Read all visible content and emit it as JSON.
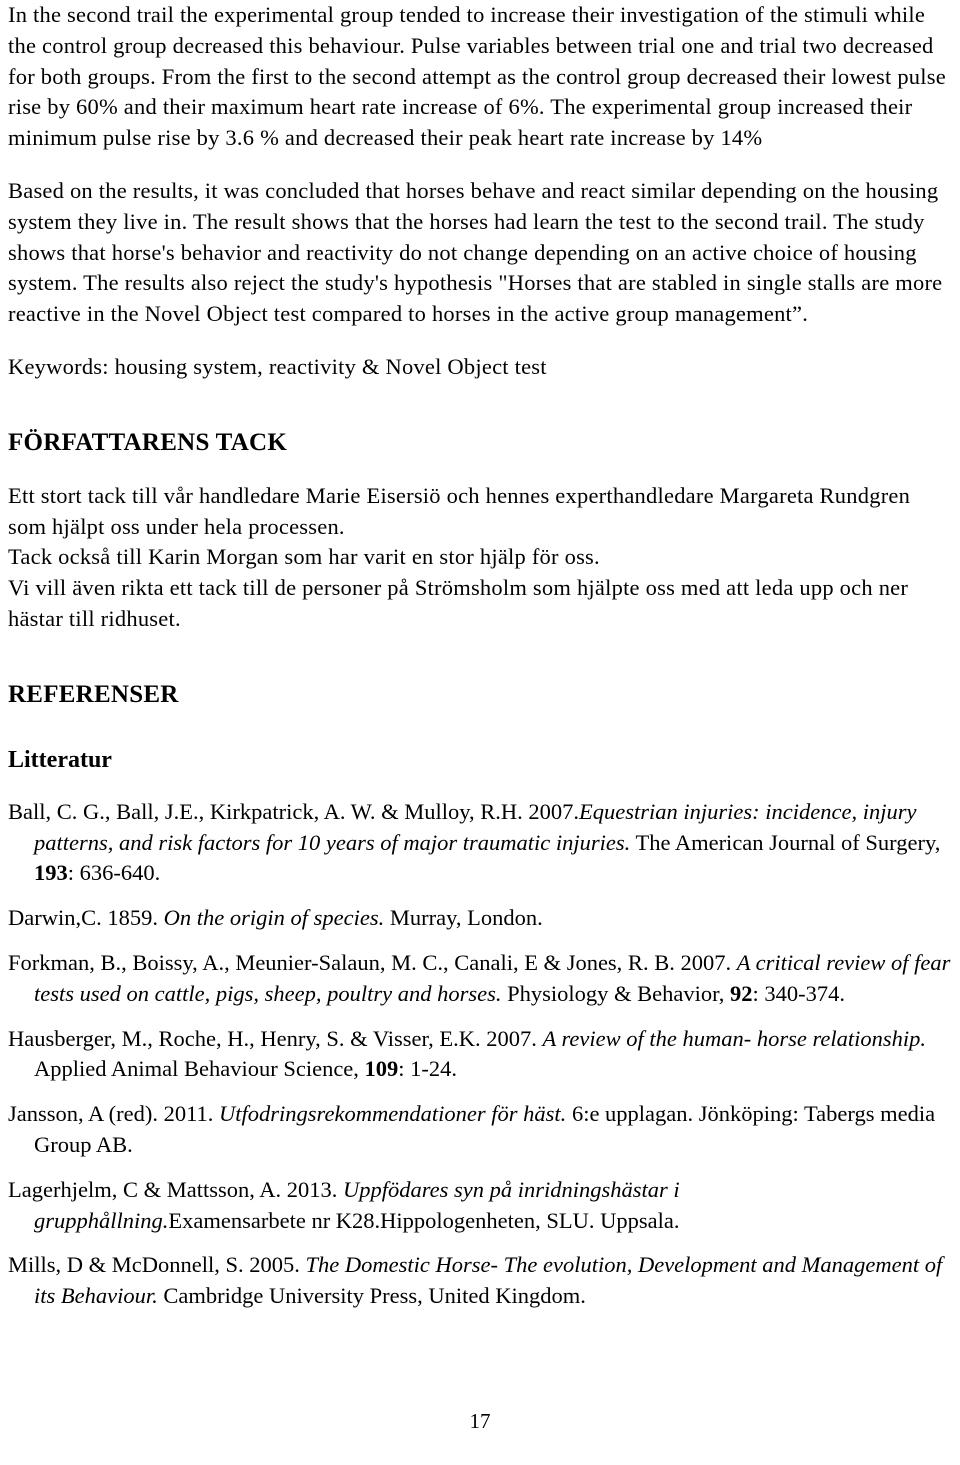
{
  "document": {
    "page_number": "17",
    "paragraphs": {
      "results_summary": "In the second trail the experimental group tended to increase their investigation of the stimuli while the control group decreased this behaviour. Pulse variables between trial one and trial two decreased for both groups. From the first to the second attempt as the control group decreased their lowest pulse rise by 60% and their maximum heart rate increase of 6%. The experimental group increased their minimum pulse rise by 3.6 % and decreased their peak heart rate increase by 14%",
      "conclusion": "Based on the results, it was concluded that horses behave and react similar depending on the housing system they live in. The result shows that the horses had learn the test to the second trail. The study shows that horse's behavior and reactivity do not change depending on an active choice of housing system. The results also reject the study's hypothesis \"Horses that are stabled in single stalls are more reactive in the Novel Object test compared to horses in the active group management”.",
      "keywords": "Keywords: housing system, reactivity & Novel Object test"
    },
    "acknowledgements": {
      "heading": "FÖRFATTARENS TACK",
      "line1": "Ett stort tack till vår handledare Marie Eisersiö och hennes experthandledare Margareta Rundgren som hjälpt oss under hela processen.",
      "line2": "Tack också till Karin Morgan som har varit en stor hjälp för oss.",
      "line3": "Vi vill även rikta ett tack till de personer på Strömsholm som hjälpte oss med att leda upp och ner hästar till ridhuset."
    },
    "references": {
      "heading": "REFERENSER",
      "subheading": "Litteratur",
      "items": [
        {
          "pre": "Ball, C. G., Ball, J.E., Kirkpatrick, A. W. & Mulloy, R.H. 2007.",
          "title": "Equestrian injuries: incidence, injury patterns, and risk factors for 10 years of major traumatic injuries.",
          "mid": " The American Journal of Surgery, ",
          "volume": "193",
          "post": ": 636-640."
        },
        {
          "pre": "Darwin,C. 1859. ",
          "title": "On the origin of species.",
          "mid": " Murray, London.",
          "volume": "",
          "post": ""
        },
        {
          "pre": "Forkman, B., Boissy, A., Meunier-Salaun, M. C., Canali, E & Jones, R. B. 2007. ",
          "title": "A critical review of fear tests used on cattle, pigs, sheep, poultry and horses.",
          "mid": " Physiology & Behavior, ",
          "volume": "92",
          "post": ": 340-374."
        },
        {
          "pre": "Hausberger, M., Roche, H., Henry, S. & Visser, E.K. 2007. ",
          "title": "A review of the human- horse relationship.",
          "mid": " Applied Animal Behaviour Science, ",
          "volume": "109",
          "post": ": 1-24."
        },
        {
          "pre": "Jansson, A (red). 2011. ",
          "title": "Utfodringsrekommendationer för häst.",
          "mid": " 6:e upplagan. Jönköping: Tabergs media Group AB.",
          "volume": "",
          "post": ""
        },
        {
          "pre": "Lagerhjelm, C & Mattsson, A. 2013. ",
          "title": "Uppfödares syn på inridningshästar i grupphållning.",
          "mid": "Examensarbete nr K28.Hippologenheten, SLU. Uppsala.",
          "volume": "",
          "post": ""
        },
        {
          "pre": "Mills, D & McDonnell, S. 2005. ",
          "title": "The Domestic Horse- The evolution, Development and Management of its Behaviour.",
          "mid": " Cambridge University Press, United Kingdom.",
          "volume": "",
          "post": ""
        }
      ]
    }
  }
}
